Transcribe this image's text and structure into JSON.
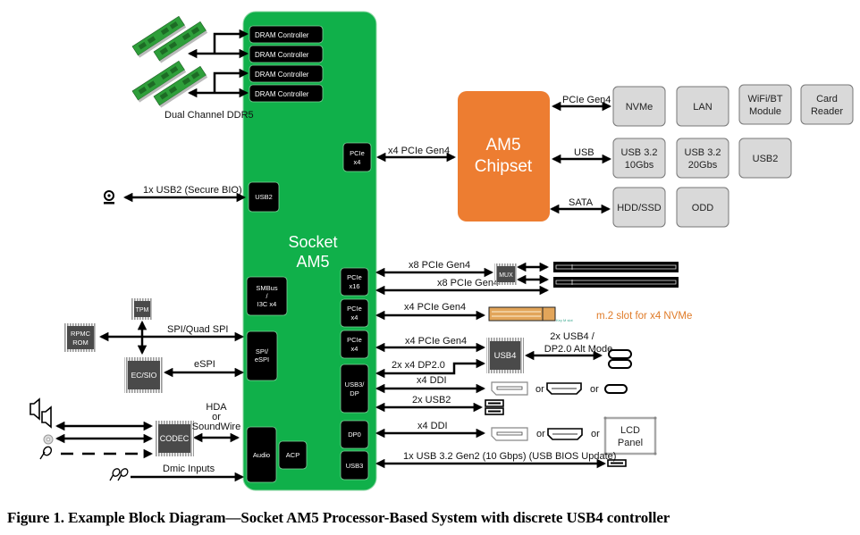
{
  "socket": {
    "title_line1": "Socket",
    "title_line2": "AM5",
    "color": "#10B04A",
    "blocks": {
      "dram": [
        "DRAM Controller",
        "DRAM Controller",
        "DRAM Controller",
        "DRAM Controller"
      ],
      "pcie_x4_top": [
        "PCIe",
        "x4"
      ],
      "usb2": "USB2",
      "smbus": [
        "SMBus",
        "/",
        "I3C x4"
      ],
      "spi": [
        "SPI/",
        "eSPI"
      ],
      "audio": "Audio",
      "acp": "ACP",
      "pcie_x16": [
        "PCIe",
        "x16"
      ],
      "pcie_x4_a": [
        "PCIe",
        "x4"
      ],
      "pcie_x4_b": [
        "PCIe",
        "x4"
      ],
      "usb3dp": [
        "USB3/",
        "DP"
      ],
      "dp0": "DP0",
      "usb3": "USB3"
    }
  },
  "memory": {
    "label": "Dual Channel DDR5"
  },
  "chipset": {
    "line1": "AM5",
    "line2": "Chipset",
    "color": "#ED7D31",
    "link_label": "x4 PCIe Gen4",
    "buses": [
      "PCIe Gen4",
      "USB",
      "SATA"
    ],
    "devices": {
      "nvme": [
        "NVMe"
      ],
      "lan": [
        "LAN"
      ],
      "wifi": [
        "WiFi/BT",
        "Module"
      ],
      "card": [
        "Card",
        "Reader"
      ],
      "usb10": [
        "USB 3.2",
        "10Gbs"
      ],
      "usb20": [
        "USB 3.2",
        "20Gbs"
      ],
      "usb2": [
        "USB2"
      ],
      "hdd": [
        "HDD/SSD"
      ],
      "odd": [
        "ODD"
      ]
    }
  },
  "left": {
    "usb2_link": "1x USB2 (Secure BIO)",
    "spi_link": "SPI/Quad SPI",
    "espi_link": "eSPI",
    "tpm": "TPM",
    "rom": [
      "RPMC",
      "ROM"
    ],
    "ec": "EC/SIO",
    "codec": "CODEC",
    "hda": [
      "HDA",
      "or",
      "SoundWire"
    ],
    "dmic": "Dmic Inputs"
  },
  "right": {
    "pcie16_a": "x8 PCIe Gen4",
    "pcie16_b": "x8 PCIe Gen4",
    "mux": "MUX",
    "m2_link": "x4 PCIe Gen4",
    "m2_key": "Key M slot",
    "m2_note": "m.2 slot for x4 NVMe",
    "m2_note_color": "#E07B28",
    "usb4_link": "x4 PCIe Gen4",
    "dp20_link": "2x x4 DP2.0",
    "usb4_chip": "USB4",
    "usb4_out": [
      "2x USB4 /",
      "DP2.0 Alt Mode"
    ],
    "ddi_a": "x4 DDI",
    "usb2x": "2x USB2",
    "ddi_b": "x4 DDI",
    "or": "or",
    "lcd": [
      "LCD",
      "Panel"
    ],
    "usb3_link": "1x USB 3.2 Gen2 (10 Gbps) (USB BIOS Update)"
  },
  "caption": "Figure 1. Example Block Diagram—Socket AM5 Processor-Based System with discrete USB4 controller"
}
